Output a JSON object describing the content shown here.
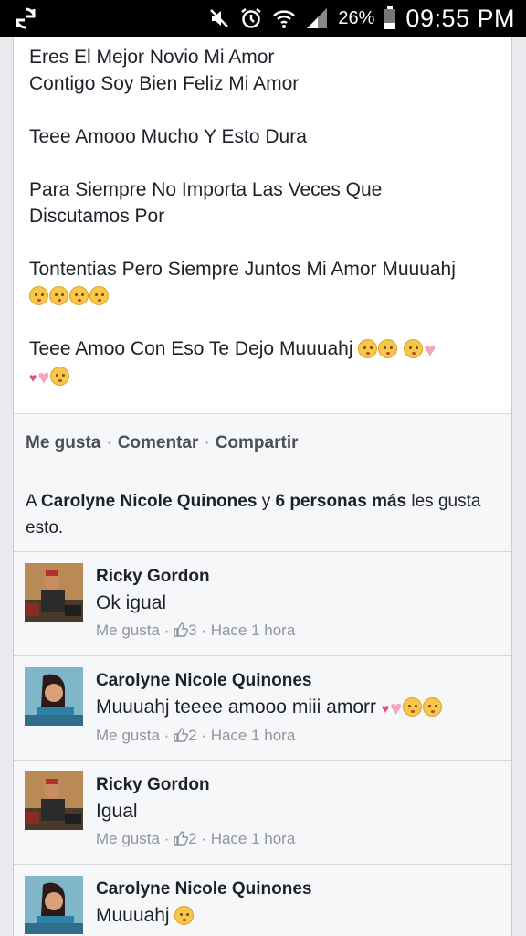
{
  "status_bar": {
    "battery_pct": "26%",
    "time": "09:55 PM",
    "icons": [
      "sync-icon",
      "mute-icon",
      "alarm-icon",
      "wifi-icon",
      "signal-icon",
      "battery-icon"
    ]
  },
  "post": {
    "line1": "Eres El Mejor Novio Mi Amor",
    "line2": "Contigo Soy Bien Feliz Mi Amor",
    "line3": "Teee Amooo Mucho Y Esto Dura",
    "line4": "Para Siempre No Importa Las Veces Que",
    "line5": "Discutamos Por",
    "line6": "Tontentias Pero Siempre Juntos Mi Amor Muuuahj",
    "line7": "Teee Amoo Con Eso Te Dejo Muuuahj"
  },
  "actions": {
    "like": "Me gusta",
    "comment": "Comentar",
    "share": "Compartir",
    "separator": "·"
  },
  "likes": {
    "prefix": "A",
    "person": "Carolyne Nicole Quinones",
    "middle": "y",
    "others": "6 personas más",
    "suffix": "les gusta esto."
  },
  "comments": [
    {
      "name": "Ricky Gordon",
      "text": "Ok igual",
      "like_label": "Me gusta",
      "sep": "·",
      "like_count": "3",
      "time": "Hace 1 hora"
    },
    {
      "name": "Carolyne Nicole Quinones",
      "text": "Muuuahj teeee amooo miii amorr",
      "like_label": "Me gusta",
      "sep": "·",
      "like_count": "2",
      "time": "Hace 1 hora"
    },
    {
      "name": "Ricky Gordon",
      "text": "Igual",
      "like_label": "Me gusta",
      "sep": "·",
      "like_count": "2",
      "time": "Hace 1 hora"
    },
    {
      "name": "Carolyne Nicole Quinones",
      "text": "Muuuahj"
    }
  ],
  "colors": {
    "text": "#1d2129",
    "meta": "#90949c",
    "background": "#e9eaed",
    "card": "#ffffff"
  }
}
